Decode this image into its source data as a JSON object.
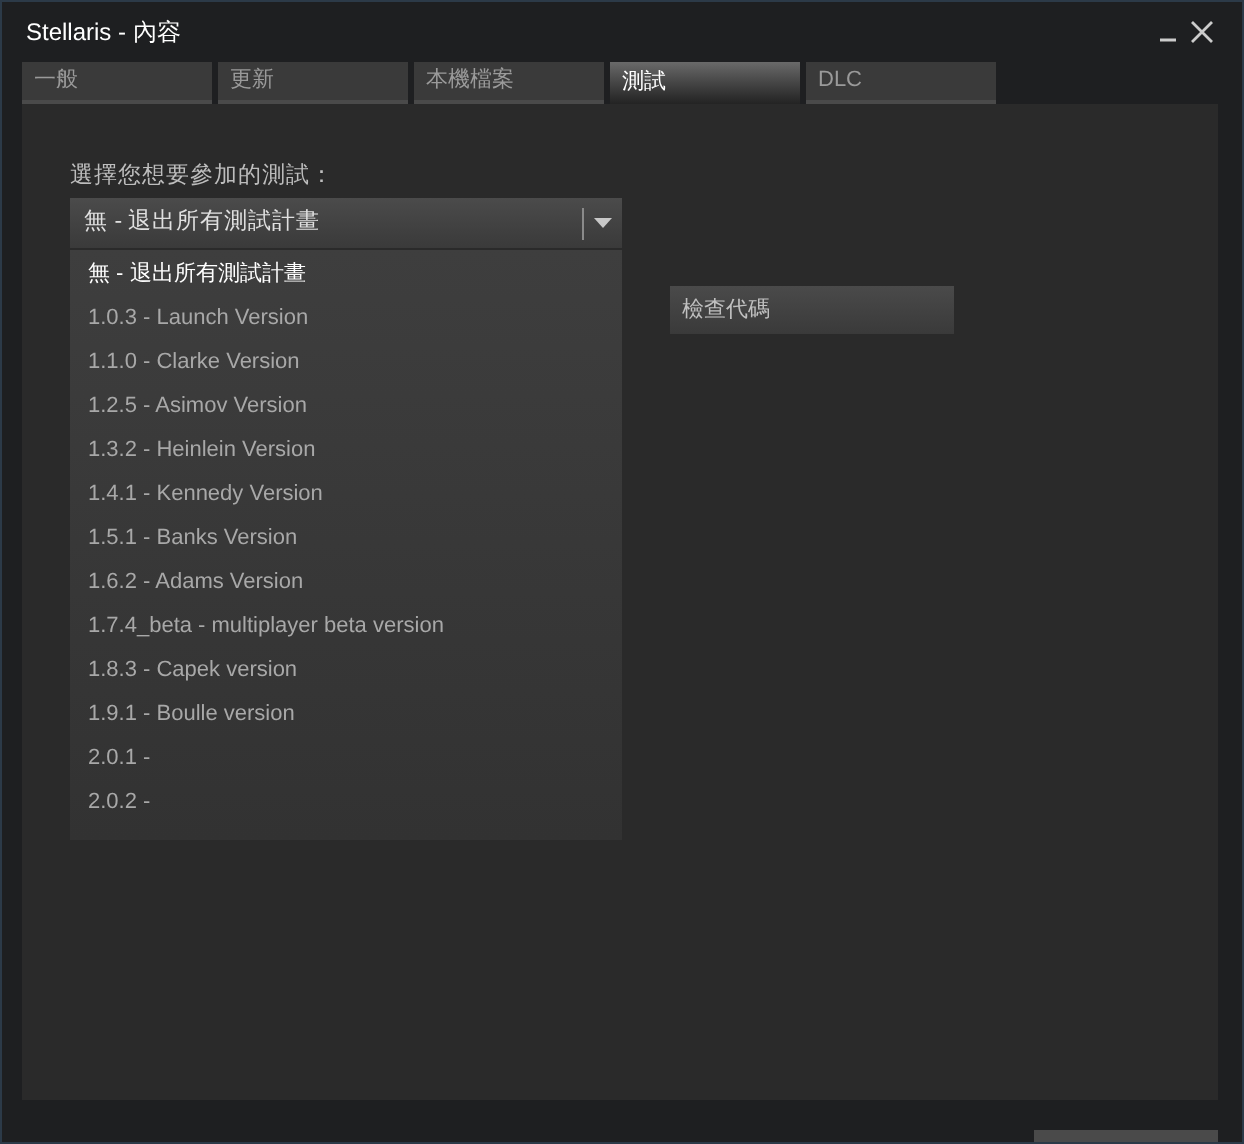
{
  "window": {
    "title": "Stellaris - 內容"
  },
  "tabs": [
    {
      "label": "一般",
      "selected": false
    },
    {
      "label": "更新",
      "selected": false
    },
    {
      "label": "本機檔案",
      "selected": false
    },
    {
      "label": "測試",
      "selected": true
    },
    {
      "label": "DLC",
      "selected": false
    }
  ],
  "beta": {
    "prompt": "選擇您想要參加的測試：",
    "dropdown": {
      "value": "無 - 退出所有測試計畫",
      "expanded": true,
      "options": [
        {
          "label": "無 - 退出所有測試計畫",
          "selected": true
        },
        {
          "label": "1.0.3 - Launch Version",
          "selected": false
        },
        {
          "label": "1.1.0 - Clarke Version",
          "selected": false
        },
        {
          "label": "1.2.5 - Asimov Version",
          "selected": false
        },
        {
          "label": "1.3.2 - Heinlein Version",
          "selected": false
        },
        {
          "label": "1.4.1 - Kennedy Version",
          "selected": false
        },
        {
          "label": "1.5.1 - Banks Version",
          "selected": false
        },
        {
          "label": "1.6.2 - Adams Version",
          "selected": false
        },
        {
          "label": "1.7.4_beta - multiplayer beta version",
          "selected": false
        },
        {
          "label": "1.8.3 - Capek version",
          "selected": false
        },
        {
          "label": "1.9.1 - Boulle version",
          "selected": false
        },
        {
          "label": "2.0.1 -",
          "selected": false
        },
        {
          "label": "2.0.2 -",
          "selected": false
        }
      ]
    },
    "check_code_button": "檢查代碼"
  }
}
